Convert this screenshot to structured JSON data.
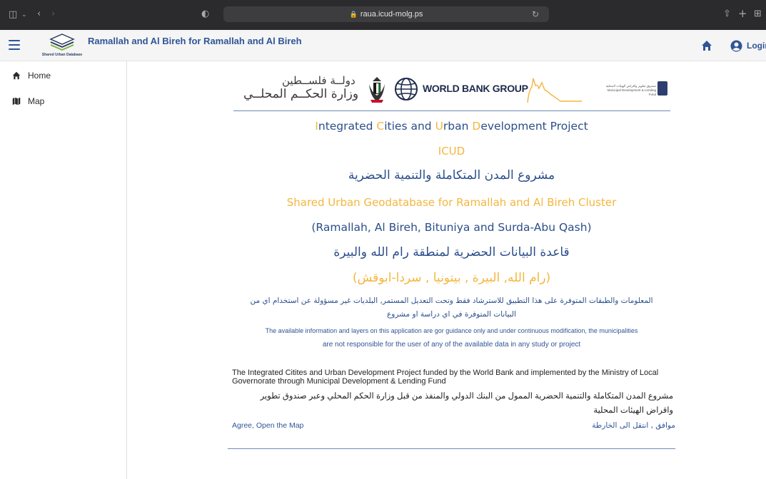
{
  "browser": {
    "url": "raua.icud-molg.ps"
  },
  "header": {
    "logo_text": "Shared Urban Database",
    "title": "Ramallah and Al Bireh for Ramallah and Al Bireh",
    "login_label": "Login"
  },
  "sidebar": {
    "items": [
      {
        "label": "Home",
        "icon": "home-icon"
      },
      {
        "label": "Map",
        "icon": "map-icon"
      }
    ]
  },
  "banner": {
    "mol_line1": "دولــة فلســطين",
    "mol_line2": "وزارة الحكــم المحلــي",
    "wbg": "WORLD BANK GROUP"
  },
  "content": {
    "project_title": {
      "I": "I",
      "ntegrated": "ntegrated ",
      "C": "C",
      "ities_and": "ities and ",
      "U": "U",
      "rban": "rban ",
      "D": "D",
      "evelopment": "evelopment Project"
    },
    "icud": "ICUD",
    "project_title_ar": "مشروع المدن المتكاملة والتنمية الحضرية",
    "geodatabase": "Shared Urban Geodatabase for Ramallah and Al Bireh Cluster",
    "localities": "(Ramallah, Al Bireh, Bituniya and Surda-Abu Qash)",
    "geodatabase_ar": "قاعدة البيانات الحضرية لمنطقة رام الله والبيرة",
    "localities_ar": "(رام الله, البيرة , بيتونيا , سردا-ابوقش)",
    "disclaimer_ar_1": "المعلومات والطبقات المتوفرة على هذا التطبيق للاسترشاد فقط وتحت التعديل المستمر, البلديات غير مسؤولة عن استخدام اي من",
    "disclaimer_ar_2": "البيانات المتوفرة في اي دراسة او مشروع",
    "disclaimer_en_1": "The available information and layers on this application are gor guidance only and under continuous modification, the municipalities",
    "disclaimer_en_2": "are not responsible for the user of any of the available data in any study or project",
    "funding_en": "The Integrated Citites and Urban Development Project funded by the World Bank and implemented by the Ministry of Local Governorate through Municipal Development & Lending Fund",
    "funding_ar": "مشروع المدن المتكاملة والتنمية الحضرية الممول من البنك الدولي والمنفذ من قبل وزارة الحكم المحلي وعبر صندوق تطوير واقراض الهيئات المحلية",
    "agree_en": "Agree, Open the Map",
    "agree_ar": "موافق , انتقل الى الخارطة"
  },
  "colors": {
    "brand_blue": "#2f5596",
    "accent_yellow": "#f4b63e",
    "text_blue": "#2b4e8a"
  }
}
